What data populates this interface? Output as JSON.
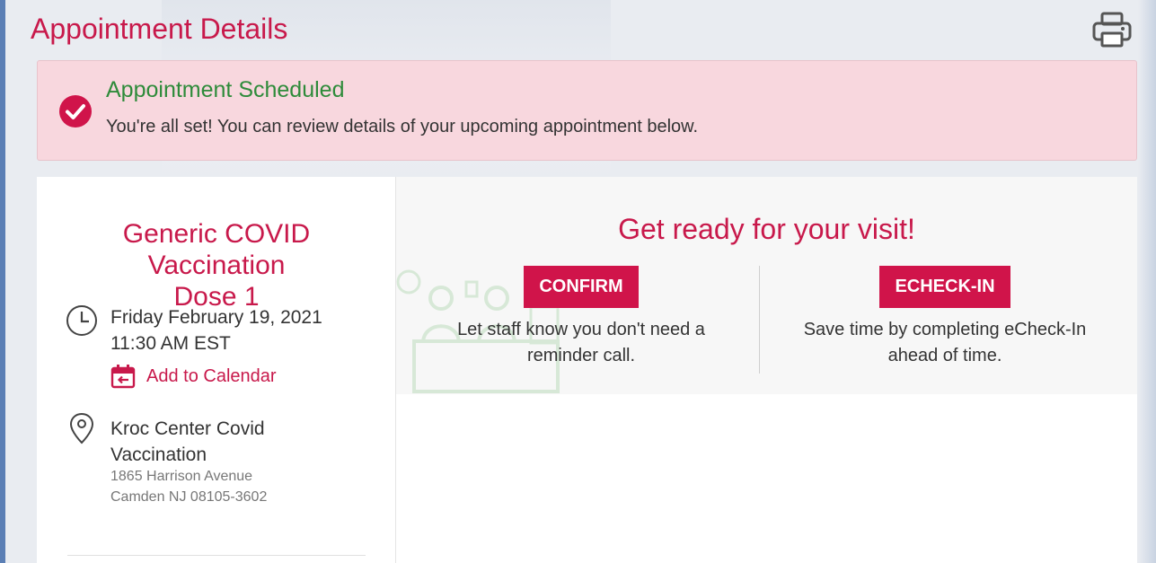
{
  "header": {
    "title": "Appointment Details",
    "print_icon": "printer-icon"
  },
  "alert": {
    "icon": "check-circle-icon",
    "title": "Appointment Scheduled",
    "message": "You're all set! You can review details of your upcoming appointment below."
  },
  "appointment": {
    "name": "Generic COVID Vaccination Dose 1",
    "date": "Friday February 19, 2021",
    "time": "11:30 AM EST",
    "add_to_calendar": "Add to Calendar",
    "location_name": "Kroc Center Covid Vaccination",
    "address_line1": "1865 Harrison Avenue",
    "address_line2": "Camden NJ 08105-3602"
  },
  "visit": {
    "title": "Get ready for your visit!",
    "confirm_label": "CONFIRM",
    "confirm_desc": "Let staff know you don't need a reminder call.",
    "echeck_label": "ECHECK-IN",
    "echeck_desc": "Save time by completing eCheck-In ahead of time."
  },
  "colors": {
    "brand": "#c8194b",
    "button": "#d0144a",
    "success": "#2e8b3a",
    "alert_bg": "#f8d7de"
  }
}
